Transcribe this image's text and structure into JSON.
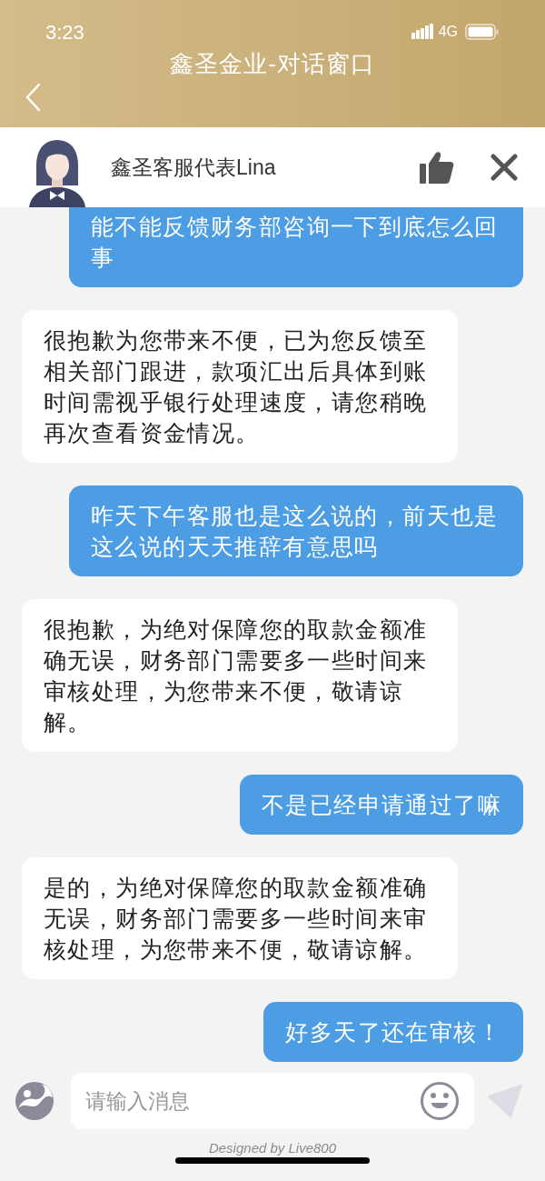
{
  "status_bar": {
    "time": "3:23",
    "network": "4G"
  },
  "header": {
    "title": "鑫圣金业-对话窗口"
  },
  "agent": {
    "name": "鑫圣客服代表Lina"
  },
  "messages": [
    {
      "kind": "user",
      "text": "能不能反馈财务部咨询一下到底怎么回事"
    },
    {
      "kind": "agent",
      "text": "很抱歉为您带来不便，已为您反馈至相关部门跟进，款项汇出后具体到账时间需视乎银行处理速度，请您稍晚再次查看资金情况。"
    },
    {
      "kind": "user",
      "text": "昨天下午客服也是这么说的，前天也是这么说的天天推辞有意思吗"
    },
    {
      "kind": "agent",
      "text": "很抱歉，为绝对保障您的取款金额准确无误，财务部门需要多一些时间来审核处理，为您带来不便，敬请谅解。"
    },
    {
      "kind": "user",
      "text": "不是已经申请通过了嘛"
    },
    {
      "kind": "agent",
      "text": "是的，为绝对保障您的取款金额准确无误，财务部门需要多一些时间来审核处理，为您带来不便，敬请谅解。"
    },
    {
      "kind": "user",
      "text": "好多天了还在审核！"
    }
  ],
  "composer": {
    "placeholder": "请输入消息"
  },
  "footer": {
    "credit": "Designed by Live800"
  }
}
